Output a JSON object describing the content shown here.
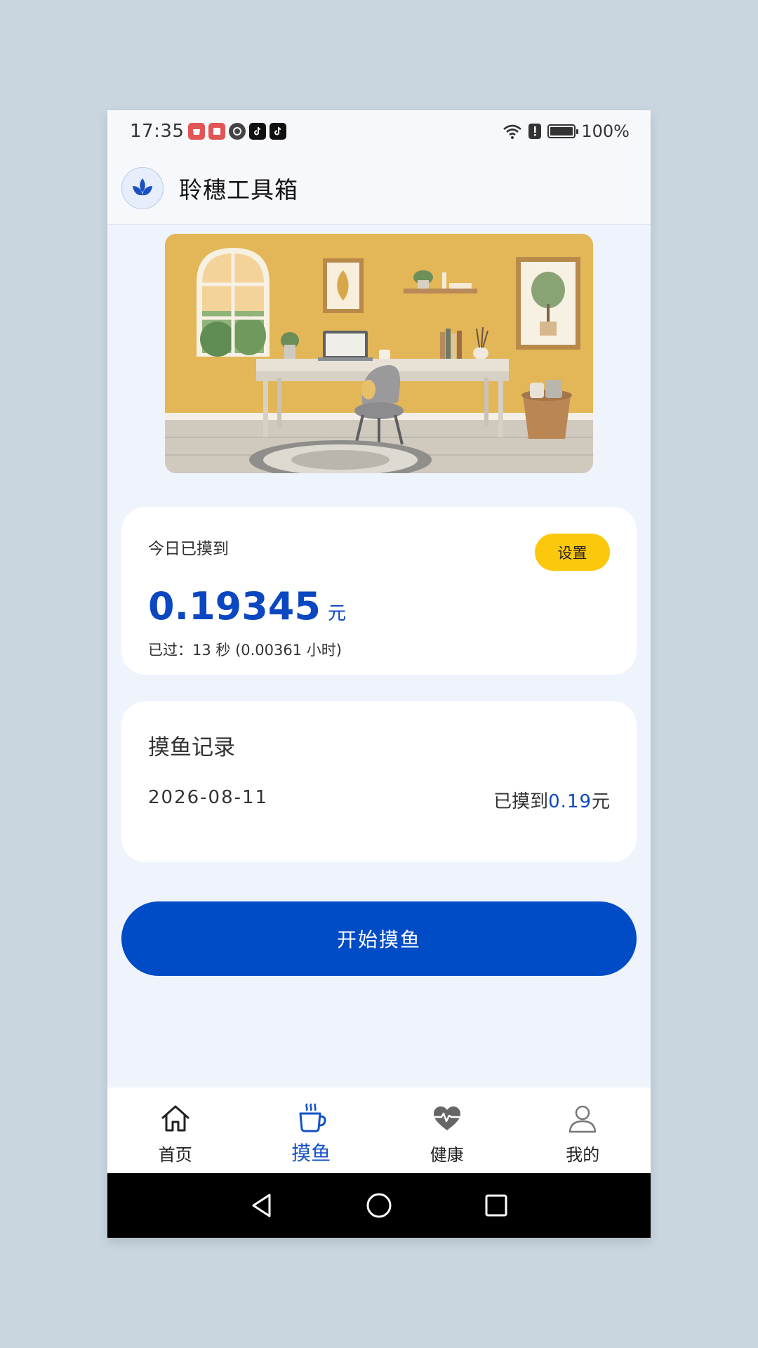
{
  "status_bar": {
    "time": "17:35",
    "battery": "100%"
  },
  "header": {
    "app_title": "聆穗工具箱"
  },
  "earnings": {
    "label": "今日已摸到",
    "settings_label": "设置",
    "amount": "0.19345",
    "unit": "元",
    "elapsed": "已过：13 秒 (0.00361 小时)"
  },
  "records": {
    "title": "摸鱼记录",
    "items": [
      {
        "date": "2026-08-11",
        "prefix": "已摸到",
        "value": "0.19",
        "suffix": "元"
      }
    ]
  },
  "start_button": {
    "label": "开始摸鱼"
  },
  "bottom_nav": {
    "items": [
      {
        "label": "首页",
        "icon": "home-icon",
        "active": false
      },
      {
        "label": "摸鱼",
        "icon": "coffee-cup-icon",
        "active": true
      },
      {
        "label": "健康",
        "icon": "heart-pulse-icon",
        "active": false
      },
      {
        "label": "我的",
        "icon": "user-icon",
        "active": false
      }
    ]
  },
  "colors": {
    "accent": "#004bc6",
    "amount_blue": "#0c47c2",
    "settings_yellow": "#fbc80e",
    "page_bg": "#eef3fc"
  }
}
